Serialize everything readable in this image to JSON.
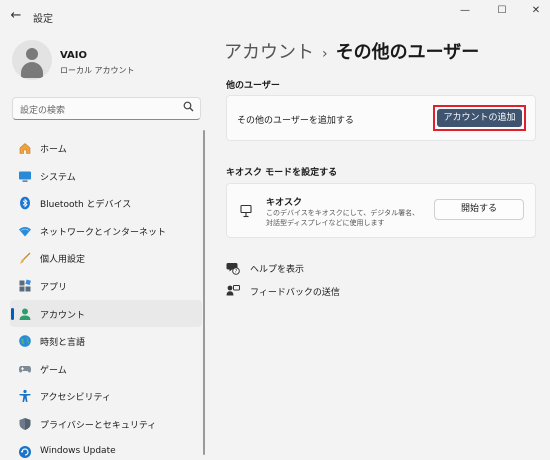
{
  "app": {
    "title": "設定"
  },
  "window_controls": {
    "minimize": "—",
    "maximize": "☐",
    "close": "✕"
  },
  "profile": {
    "name": "VAIO",
    "account_type": "ローカル アカウント"
  },
  "search": {
    "placeholder": "設定の検索"
  },
  "sidebar": {
    "items": [
      {
        "label": "ホーム",
        "icon": "home-icon",
        "selected": false
      },
      {
        "label": "システム",
        "icon": "system-icon",
        "selected": false
      },
      {
        "label": "Bluetooth とデバイス",
        "icon": "bluetooth-icon",
        "selected": false
      },
      {
        "label": "ネットワークとインターネット",
        "icon": "network-icon",
        "selected": false
      },
      {
        "label": "個人用設定",
        "icon": "personalization-icon",
        "selected": false
      },
      {
        "label": "アプリ",
        "icon": "apps-icon",
        "selected": false
      },
      {
        "label": "アカウント",
        "icon": "accounts-icon",
        "selected": true
      },
      {
        "label": "時刻と言語",
        "icon": "time-language-icon",
        "selected": false
      },
      {
        "label": "ゲーム",
        "icon": "gaming-icon",
        "selected": false
      },
      {
        "label": "アクセシビリティ",
        "icon": "accessibility-icon",
        "selected": false
      },
      {
        "label": "プライバシーとセキュリティ",
        "icon": "privacy-icon",
        "selected": false
      },
      {
        "label": "Windows Update",
        "icon": "windows-update-icon",
        "selected": false
      }
    ]
  },
  "breadcrumb": {
    "parent": "アカウント",
    "separator": "›",
    "current": "その他のユーザー"
  },
  "other_users": {
    "section_title": "他のユーザー",
    "row_label": "その他のユーザーを追加する",
    "add_button": "アカウントの追加"
  },
  "kiosk": {
    "section_title": "キオスク モードを設定する",
    "title": "キオスク",
    "description": "このデバイスをキオスクにして、デジタル署名、対話型ディスプレイなどに使用します",
    "start_button": "開始する"
  },
  "links": {
    "help": "ヘルプを表示",
    "feedback": "フィードバックの送信"
  },
  "colors": {
    "accent": "#005fb8",
    "primary_button": "#3f5470",
    "highlight_border": "#e0202a",
    "background": "#f3f3f3"
  }
}
